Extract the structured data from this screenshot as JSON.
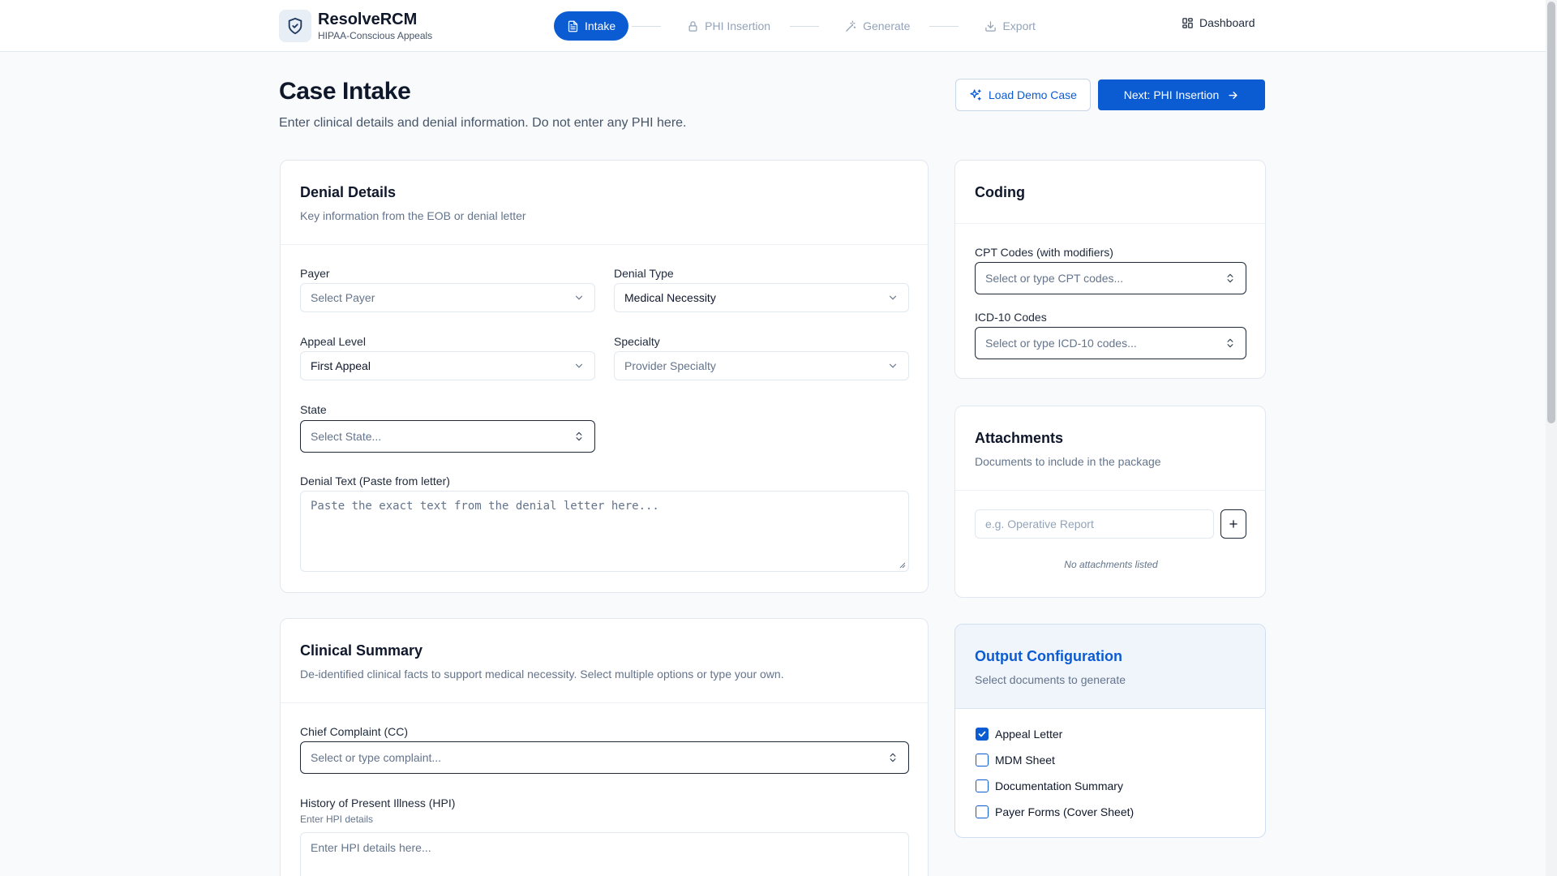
{
  "brand": {
    "name": "ResolveRCM",
    "subtitle": "HIPAA-Conscious Appeals",
    "logo_icon": "shield-check-icon"
  },
  "steps": [
    {
      "label": "Intake",
      "icon": "document-icon",
      "active": true
    },
    {
      "label": "PHI Insertion",
      "icon": "lock-icon",
      "active": false
    },
    {
      "label": "Generate",
      "icon": "magic-wand-icon",
      "active": false
    },
    {
      "label": "Export",
      "icon": "download-icon",
      "active": false
    }
  ],
  "header": {
    "dashboard_label": "Dashboard"
  },
  "page": {
    "title": "Case Intake",
    "subtitle": "Enter clinical details and denial information. Do not enter any PHI here.",
    "demo_button": "Load Demo Case",
    "next_button": "Next: PHI Insertion"
  },
  "denial": {
    "title": "Denial Details",
    "description": "Key information from the EOB or denial letter",
    "payer_label": "Payer",
    "payer_placeholder": "Select Payer",
    "denial_type_label": "Denial Type",
    "denial_type_value": "Medical Necessity",
    "appeal_level_label": "Appeal Level",
    "appeal_level_value": "First Appeal",
    "specialty_label": "Specialty",
    "specialty_placeholder": "Provider Specialty",
    "state_label": "State",
    "state_placeholder": "Select State...",
    "text_label": "Denial Text (Paste from letter)",
    "text_placeholder": "Paste the exact text from the denial letter here..."
  },
  "clinical": {
    "title": "Clinical Summary",
    "description": "De-identified clinical facts to support medical necessity. Select multiple options or type your own.",
    "cc_label": "Chief Complaint (CC)",
    "cc_placeholder": "Select or type complaint...",
    "hpi_label": "History of Present Illness (HPI)",
    "hpi_hint": "Enter HPI details",
    "hpi_placeholder": "Enter HPI details here..."
  },
  "coding": {
    "title": "Coding",
    "cpt_label": "CPT Codes (with modifiers)",
    "cpt_placeholder": "Select or type CPT codes...",
    "icd_label": "ICD-10 Codes",
    "icd_placeholder": "Select or type ICD-10 codes..."
  },
  "attachments": {
    "title": "Attachments",
    "description": "Documents to include in the package",
    "input_placeholder": "e.g. Operative Report",
    "empty_text": "No attachments listed"
  },
  "output": {
    "title": "Output Configuration",
    "description": "Select documents to generate",
    "options": [
      {
        "label": "Appeal Letter",
        "checked": true
      },
      {
        "label": "MDM Sheet",
        "checked": false
      },
      {
        "label": "Documentation Summary",
        "checked": false
      },
      {
        "label": "Payer Forms (Cover Sheet)",
        "checked": false
      }
    ]
  },
  "colors": {
    "primary": "#0b5bd3",
    "border": "#e2e8f0",
    "muted": "#64748b",
    "output_head_bg": "#f0f5fc"
  }
}
